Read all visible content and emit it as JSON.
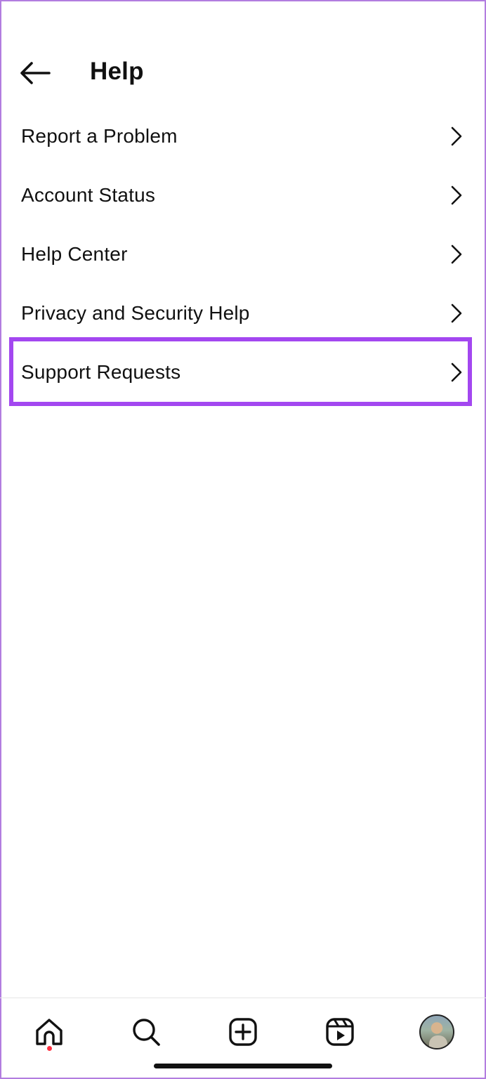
{
  "header": {
    "title": "Help"
  },
  "menu": {
    "items": [
      {
        "label": "Report a Problem"
      },
      {
        "label": "Account Status"
      },
      {
        "label": "Help Center"
      },
      {
        "label": "Privacy and Security Help"
      },
      {
        "label": "Support Requests",
        "highlighted": true
      }
    ]
  },
  "tabbar": {
    "tabs": [
      {
        "icon": "home-icon",
        "active": true,
        "has_notification": true
      },
      {
        "icon": "search-icon"
      },
      {
        "icon": "create-icon"
      },
      {
        "icon": "reels-icon"
      },
      {
        "icon": "profile-avatar"
      }
    ]
  },
  "colors": {
    "highlight": "#a347f0",
    "frame": "#b27de0",
    "notification_dot": "#ff3040"
  }
}
